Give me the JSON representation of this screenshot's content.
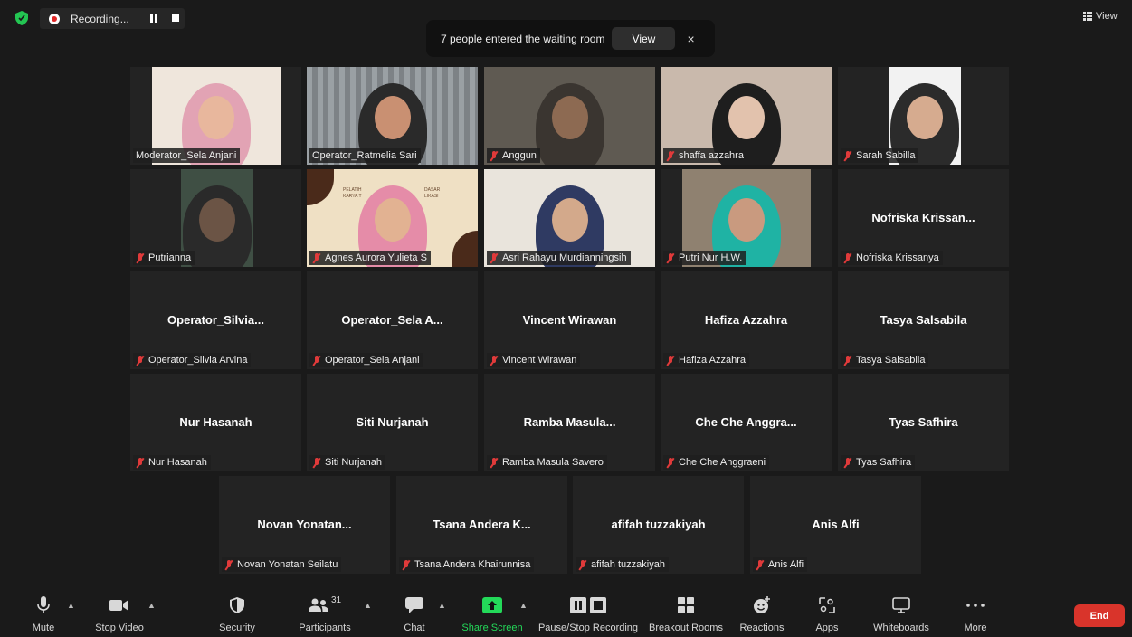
{
  "recording": {
    "label": "Recording..."
  },
  "notification": {
    "text": "7 people entered the waiting room",
    "view_label": "View",
    "close": "×"
  },
  "view_button": {
    "label": "View"
  },
  "participants": [
    {
      "label": "Moderator_Sela Anjani",
      "display": "",
      "video": true,
      "muted": false
    },
    {
      "label": "Operator_Ratmelia Sari",
      "display": "",
      "video": true,
      "muted": false,
      "active": true
    },
    {
      "label": "Anggun",
      "display": "",
      "video": true,
      "muted": true
    },
    {
      "label": "shaffa azzahra",
      "display": "",
      "video": true,
      "muted": true
    },
    {
      "label": "Sarah Sabilla",
      "display": "",
      "video": true,
      "muted": true
    },
    {
      "label": "Putrianna",
      "display": "",
      "video": true,
      "muted": true
    },
    {
      "label": "Agnes Aurora Yulieta S",
      "display": "",
      "video": true,
      "muted": true,
      "bg_text_left": "PELATIH",
      "bg_text_left2": "KARYA T",
      "bg_text_right": "DASAR",
      "bg_text_right2": "LIKASI"
    },
    {
      "label": "Asri Rahayu Murdianningsih",
      "display": "",
      "video": true,
      "muted": true
    },
    {
      "label": "Putri Nur H.W.",
      "display": "",
      "video": true,
      "muted": true
    },
    {
      "label": "Nofriska Krissanya",
      "display": "Nofriska Krissan...",
      "video": false,
      "muted": true
    },
    {
      "label": "Operator_Silvia Arvina",
      "display": "Operator_Silvia...",
      "video": false,
      "muted": true
    },
    {
      "label": "Operator_Sela Anjani",
      "display": "Operator_Sela A...",
      "video": false,
      "muted": true
    },
    {
      "label": "Vincent Wirawan",
      "display": "Vincent Wirawan",
      "video": false,
      "muted": true
    },
    {
      "label": "Hafiza Azzahra",
      "display": "Hafiza Azzahra",
      "video": false,
      "muted": true
    },
    {
      "label": "Tasya Salsabila",
      "display": "Tasya Salsabila",
      "video": false,
      "muted": true
    },
    {
      "label": "Nur Hasanah",
      "display": "Nur Hasanah",
      "video": false,
      "muted": true
    },
    {
      "label": "Siti Nurjanah",
      "display": "Siti Nurjanah",
      "video": false,
      "muted": true
    },
    {
      "label": "Ramba Masula Savero",
      "display": "Ramba Masula...",
      "video": false,
      "muted": true
    },
    {
      "label": "Che Che Anggraeni",
      "display": "Che Che Anggra...",
      "video": false,
      "muted": true
    },
    {
      "label": "Tyas Safhira",
      "display": "Tyas Safhira",
      "video": false,
      "muted": true
    },
    {
      "label": "Novan Yonatan Seilatu",
      "display": "Novan Yonatan...",
      "video": false,
      "muted": true
    },
    {
      "label": "Tsana Andera Khairunnisa",
      "display": "Tsana Andera K...",
      "video": false,
      "muted": true
    },
    {
      "label": "afifah tuzzakiyah",
      "display": "afifah tuzzakiyah",
      "video": false,
      "muted": true
    },
    {
      "label": "Anis Alfi",
      "display": "Anis Alfi",
      "video": false,
      "muted": true
    }
  ],
  "toolbar": {
    "mute": "Mute",
    "stop_video": "Stop Video",
    "security": "Security",
    "participants": "Participants",
    "participants_count": "31",
    "chat": "Chat",
    "share_screen": "Share Screen",
    "pause_recording": "Pause/Stop Recording",
    "breakout_rooms": "Breakout Rooms",
    "reactions": "Reactions",
    "apps": "Apps",
    "whiteboards": "Whiteboards",
    "more": "More",
    "end": "End"
  },
  "colors": {
    "active_speaker": "#c6e17a",
    "share_green": "#23d959",
    "end_red": "#d9342b",
    "muted_red": "#e03a3a"
  }
}
